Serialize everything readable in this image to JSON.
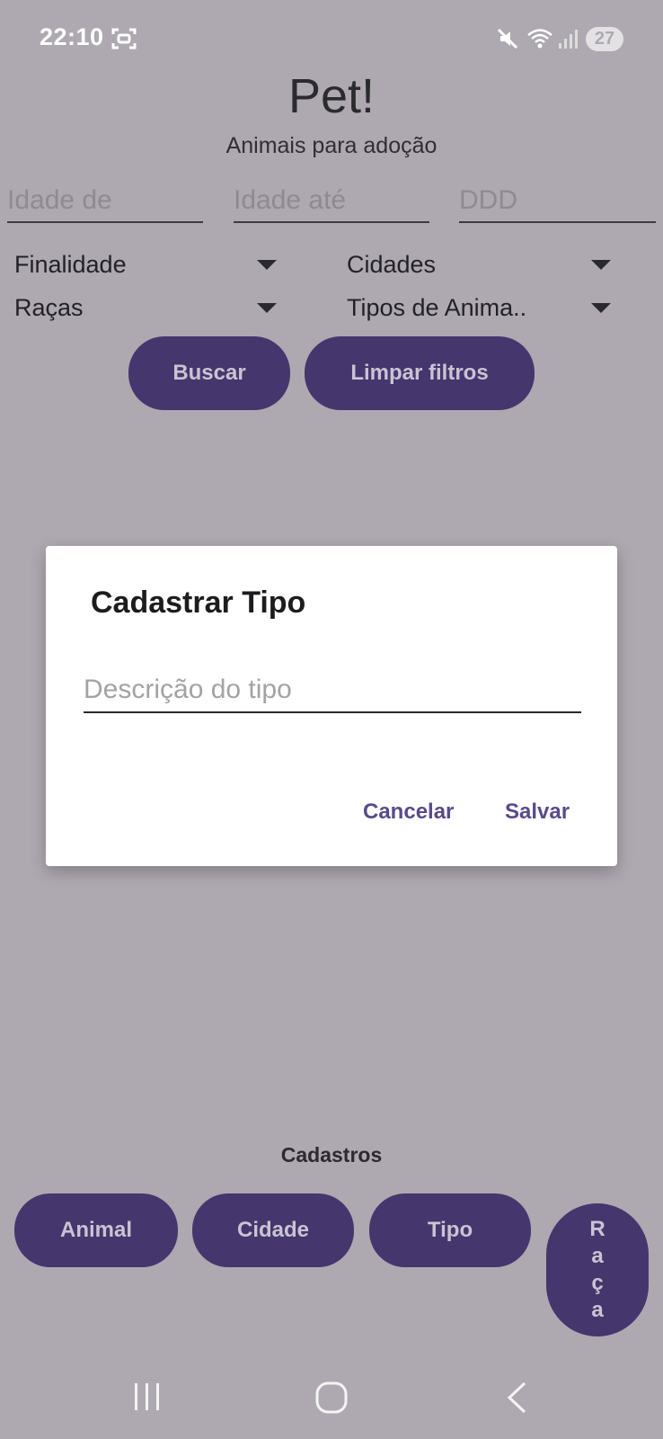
{
  "status_bar": {
    "time": "22:10",
    "battery": "27",
    "icons": [
      "screenshot-icon",
      "mute-icon",
      "wifi-icon",
      "signal-icon"
    ]
  },
  "header": {
    "title": "Pet!",
    "subtitle": "Animais para adoção"
  },
  "filters": {
    "age_from_placeholder": "Idade de",
    "age_to_placeholder": "Idade até",
    "ddd_placeholder": "DDD",
    "finalidade": "Finalidade",
    "cidades": "Cidades",
    "racas": "Raças",
    "tipos": "Tipos de Anima.."
  },
  "actions": {
    "search": "Buscar",
    "clear": "Limpar filtros"
  },
  "dialog": {
    "title": "Cadastrar Tipo",
    "input_placeholder": "Descrição do tipo",
    "cancel": "Cancelar",
    "save": "Salvar"
  },
  "registrations": {
    "label": "Cadastros",
    "animal": "Animal",
    "cidade": "Cidade",
    "tipo": "Tipo",
    "raca": "Raça"
  },
  "colors": {
    "background": "#aea9b0",
    "accent": "#45366d",
    "accent_text": "#c9c4d3",
    "dialog_button": "#5a4a8a"
  }
}
